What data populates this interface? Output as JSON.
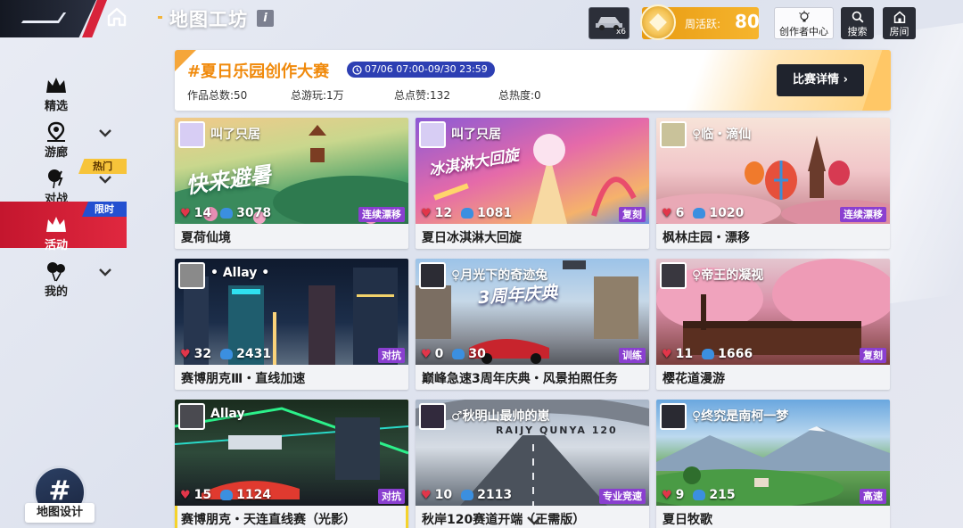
{
  "header": {
    "title": "地图工坊",
    "info_icon": "i",
    "car_count": "x6",
    "weekly_label": "周活跃:",
    "weekly_value": "80",
    "creator_center": "创作者中心",
    "search": "搜索",
    "room": "房间"
  },
  "sidebar": {
    "items": [
      {
        "label": "精选",
        "icon": "crown-icon"
      },
      {
        "label": "游廊",
        "icon": "location-pin-icon"
      },
      {
        "label": "对战",
        "icon": "balloon-flash-icon",
        "tag": "热门"
      },
      {
        "label": "活动",
        "icon": "crown-icon",
        "tag": "限时",
        "active": true
      },
      {
        "label": "我的",
        "icon": "balloons-icon"
      }
    ],
    "design_label": "地图设计",
    "design_icon": "#"
  },
  "banner": {
    "title": "#夏日乐园创作大赛",
    "date": "07/06 07:00-09/30 23:59",
    "stats": {
      "works": "作品总数:50",
      "plays": "总游玩:1万",
      "likes": "总点赞:132",
      "heat": "总热度:0"
    },
    "detail_button": "比赛详情"
  },
  "cards": [
    {
      "author": "叫了只居",
      "likes": "14",
      "plays": "3078",
      "category": "连续漂移",
      "name": "夏荷仙境",
      "overlay": "快来避暑",
      "theme": "summer-lotus",
      "cat_color": "#8a3fd0"
    },
    {
      "author": "叫了只居",
      "likes": "12",
      "plays": "1081",
      "category": "复刻",
      "name": "夏日冰淇淋大回旋",
      "overlay": "冰淇淋大回旋",
      "theme": "icecream",
      "cat_color": "#8a3fd0"
    },
    {
      "author": "♀临・滴仙",
      "likes": "6",
      "plays": "1020",
      "category": "连续漂移",
      "name": "枫林庄园・漂移",
      "overlay": "",
      "theme": "balloon",
      "cat_color": "#8a3fd0"
    },
    {
      "author": "• Allay •",
      "likes": "32",
      "plays": "2431",
      "category": "对抗",
      "name": "赛博朋克Ⅲ・直线加速",
      "overlay": "",
      "theme": "cyber",
      "cat_color": "#8a3fd0"
    },
    {
      "author": "♀月光下的奇迹兔",
      "likes": "0",
      "plays": "30",
      "category": "训练",
      "name": "巅峰急速3周年庆典・风景拍照任务",
      "overlay": "3周年庆典",
      "theme": "street",
      "cat_color": "#8a3fd0"
    },
    {
      "author": "♀帝王的凝视",
      "likes": "11",
      "plays": "1666",
      "category": "复刻",
      "name": "樱花道漫游",
      "overlay": "",
      "theme": "sakura",
      "cat_color": "#8a3fd0"
    },
    {
      "author": "Allay",
      "likes": "15",
      "plays": "1124",
      "category": "对抗",
      "name": "赛博朋克・天连直线赛（光影）",
      "overlay": "",
      "theme": "neon",
      "cat_color": "#8a3fd0"
    },
    {
      "author": "♂秋明山最帅的崽",
      "likes": "10",
      "plays": "2113",
      "category": "专业竞速",
      "name": "秋岸120赛道开端（正需版）",
      "overlay": "RAIJY QUNYA 120",
      "theme": "track",
      "cat_color": "#8a3fd0"
    },
    {
      "author": "♀终究是南柯一梦",
      "likes": "9",
      "plays": "215",
      "category": "高速",
      "name": "夏日牧歌",
      "overlay": "",
      "theme": "meadow",
      "cat_color": "#8a3fd0"
    }
  ]
}
